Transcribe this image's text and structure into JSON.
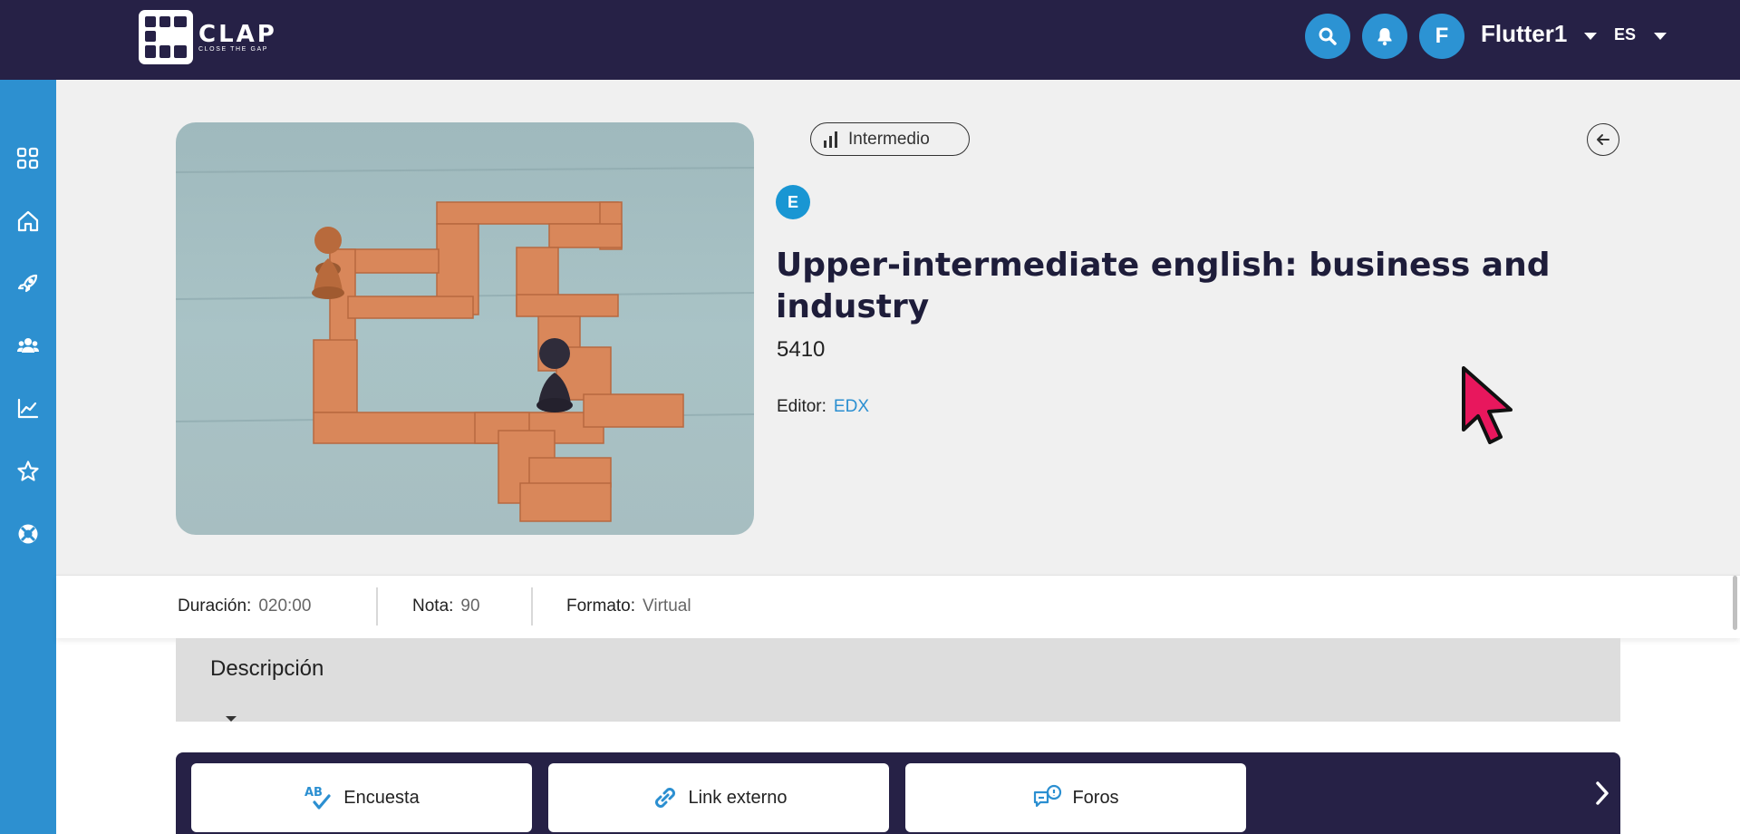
{
  "header": {
    "logo_text": "CLAP",
    "logo_tagline": "CLOSE THE GAP",
    "search_icon": "search-icon",
    "bell_icon": "bell-icon",
    "avatar_initial": "F",
    "user_name": "Flutter1",
    "language": "ES"
  },
  "sidebar": {
    "items": [
      {
        "icon": "grid-icon"
      },
      {
        "icon": "home-icon"
      },
      {
        "icon": "rocket-icon"
      },
      {
        "icon": "users-icon"
      },
      {
        "icon": "chart-icon"
      },
      {
        "icon": "star-icon"
      },
      {
        "icon": "lifebuoy-icon"
      }
    ]
  },
  "course": {
    "level": "Intermedio",
    "provider_badge": "E",
    "title": "Upper-intermediate english: business and industry",
    "code": "5410",
    "editor_label": "Editor:",
    "editor_value": "EDX"
  },
  "info": {
    "duration_label": "Duración:",
    "duration_value": "020:00",
    "grade_label": "Nota:",
    "grade_value": "90",
    "format_label": "Formato:",
    "format_value": "Virtual"
  },
  "description": {
    "title": "Descripción"
  },
  "resources": {
    "items": [
      {
        "label": "Encuesta",
        "icon": "survey-icon"
      },
      {
        "label": "Link externo",
        "icon": "link-icon"
      },
      {
        "label": "Foros",
        "icon": "forum-icon"
      }
    ]
  },
  "colors": {
    "topbar": "#262146",
    "sidebar": "#2d90d0",
    "accent": "#2b8fd1",
    "cursor": "#e8175d"
  }
}
